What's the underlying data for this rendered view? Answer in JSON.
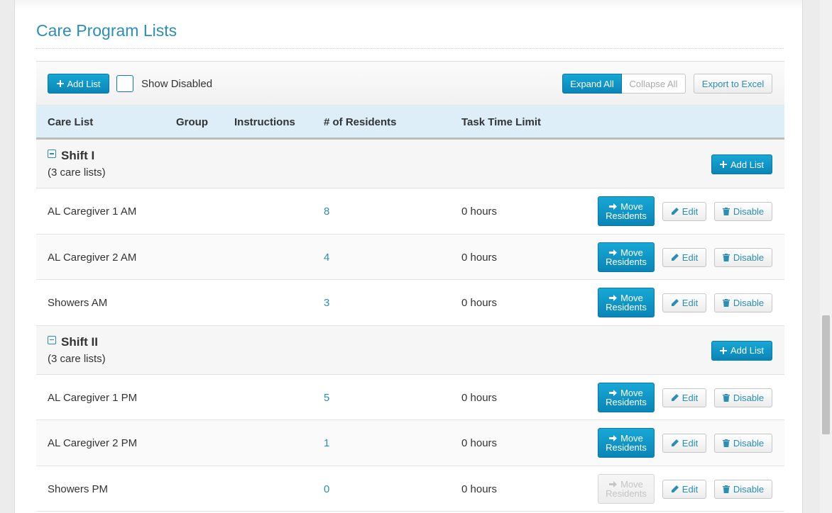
{
  "page": {
    "title": "Care Program Lists"
  },
  "toolbar": {
    "add_list": "Add List",
    "show_disabled": "Show Disabled",
    "expand_all": "Expand All",
    "collapse_all": "Collapse All",
    "export": "Export to Excel"
  },
  "table": {
    "headers": [
      "Care List",
      "Group",
      "Instructions",
      "# of Residents",
      "Task Time Limit"
    ]
  },
  "row_actions": {
    "move_line1": "Move",
    "move_line2": "Residents",
    "edit": "Edit",
    "disable": "Disable"
  },
  "groups": [
    {
      "name": "Shift I",
      "count": "(3 care lists)",
      "add_list": "Add List",
      "rows": [
        {
          "name": "AL Caregiver 1 AM",
          "residents": "8",
          "time": "0 hours",
          "move_enabled": true
        },
        {
          "name": "AL Caregiver 2 AM",
          "residents": "4",
          "time": "0 hours",
          "move_enabled": true
        },
        {
          "name": "Showers AM",
          "residents": "3",
          "time": "0 hours",
          "move_enabled": true
        }
      ]
    },
    {
      "name": "Shift II",
      "count": "(3 care lists)",
      "add_list": "Add List",
      "rows": [
        {
          "name": "AL Caregiver 1 PM",
          "residents": "5",
          "time": "0 hours",
          "move_enabled": true
        },
        {
          "name": "AL Caregiver 2 PM",
          "residents": "1",
          "time": "0 hours",
          "move_enabled": true
        },
        {
          "name": "Showers PM",
          "residents": "0",
          "time": "0 hours",
          "move_enabled": false
        }
      ]
    }
  ],
  "colors": {
    "accent": "#2a8fb5",
    "primary_button": "#0a85b7",
    "header_bg": "#ddeef8"
  },
  "icons": {
    "add": "plus-icon",
    "move": "arrow-right-icon",
    "edit": "pencil-icon",
    "disable": "trash-icon",
    "toggle": "minus-square-icon"
  }
}
